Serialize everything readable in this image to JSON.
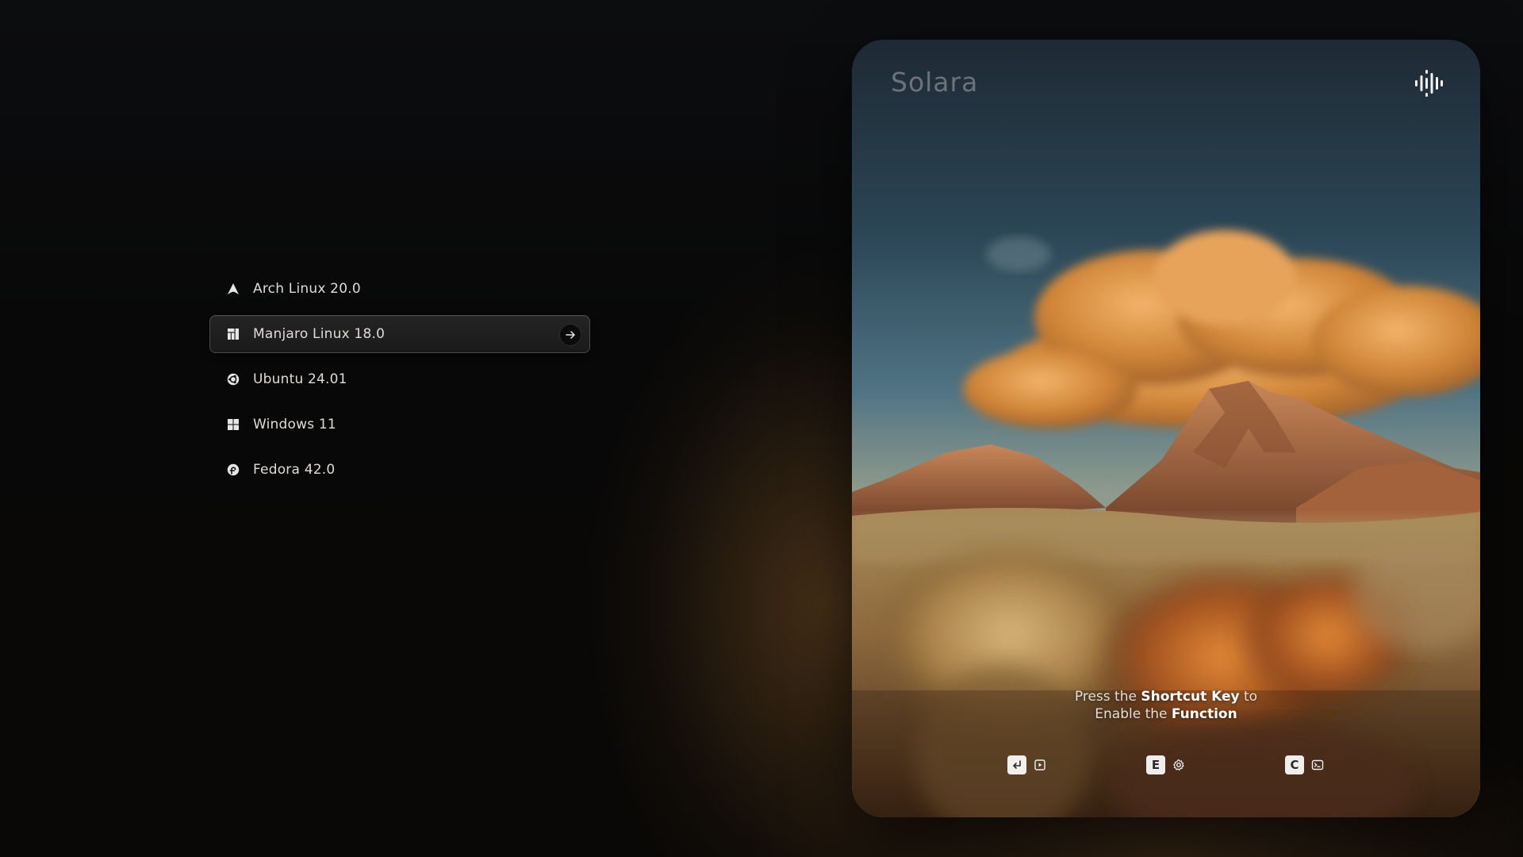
{
  "os_list": {
    "items": [
      {
        "label": "Arch Linux 20.0",
        "icon": "arch-linux-icon",
        "selected": false
      },
      {
        "label": "Manjaro Linux 18.0",
        "icon": "manjaro-linux-icon",
        "selected": true
      },
      {
        "label": "Ubuntu 24.01",
        "icon": "ubuntu-icon",
        "selected": false
      },
      {
        "label": "Windows 11",
        "icon": "windows-icon",
        "selected": false
      },
      {
        "label": "Fedora 42.0",
        "icon": "fedora-icon",
        "selected": false
      }
    ],
    "go_icon": "arrow-right-icon"
  },
  "preview": {
    "brand": "Solara",
    "voice_icon": "audio-waveform-icon",
    "hint": {
      "line1_prefix": "Press the ",
      "line1_bold": "Shortcut Key",
      "line1_suffix": " to",
      "line2_prefix": "Enable the ",
      "line2_bold": "Function"
    },
    "shortcuts": [
      {
        "key": "↵",
        "key_icon": "enter-key-icon",
        "function_icon": "boot-icon"
      },
      {
        "key": "E",
        "key_icon": "e-key",
        "function_icon": "settings-gear-icon"
      },
      {
        "key": "C",
        "key_icon": "c-key",
        "function_icon": "terminal-icon"
      }
    ]
  },
  "colors": {
    "background": "#070707",
    "selected_item_bg": "#1f1f1f",
    "selected_item_border": "#4a4a4a",
    "text": "#dedbd6",
    "sky_top": "#23303a",
    "cloud": "#d98a3c",
    "rock": "#b06a44"
  }
}
